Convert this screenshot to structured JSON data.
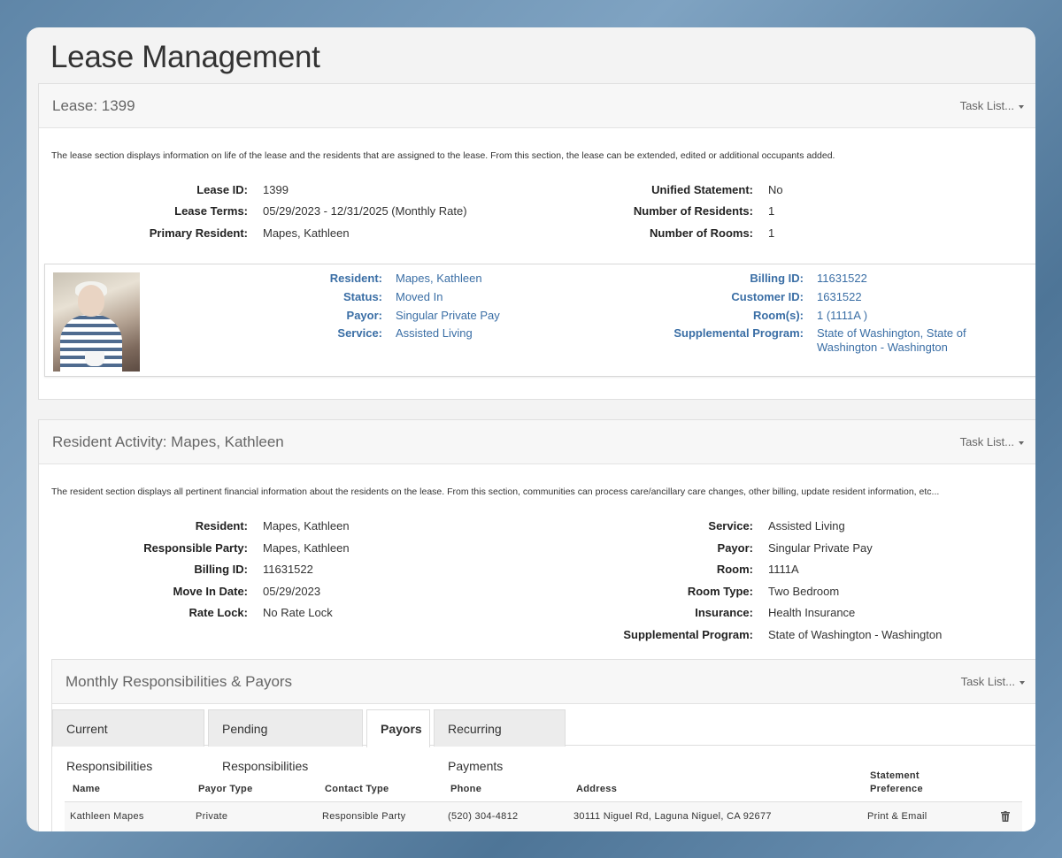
{
  "page": {
    "title": "Lease Management"
  },
  "lease_panel": {
    "title": "Lease: 1399",
    "task_list": "Task List...",
    "description": "The lease section displays information on life of the lease and the residents that are assigned to the lease. From this section, the lease can be extended, edited or additional occupants added.",
    "fields_left": [
      {
        "label": "Lease ID:",
        "value": "1399"
      },
      {
        "label": "Lease Terms:",
        "value": "05/29/2023 - 12/31/2025 (Monthly Rate)"
      },
      {
        "label": "Primary Resident:",
        "value": "Mapes, Kathleen"
      }
    ],
    "fields_right": [
      {
        "label": "Unified Statement:",
        "value": "No"
      },
      {
        "label": "Number of Residents:",
        "value": "1"
      },
      {
        "label": "Number of Rooms:",
        "value": "1"
      }
    ],
    "resident_card": {
      "left": [
        {
          "label": "Resident:",
          "value": "Mapes, Kathleen"
        },
        {
          "label": "Status:",
          "value": "Moved In"
        },
        {
          "label": "Payor:",
          "value": "Singular Private Pay"
        },
        {
          "label": "Service:",
          "value": "Assisted Living"
        }
      ],
      "right": [
        {
          "label": "Billing ID:",
          "value": "11631522"
        },
        {
          "label": "Customer ID:",
          "value": "1631522"
        },
        {
          "label": "Room(s):",
          "value": "1 (1111A )"
        },
        {
          "label": "Supplemental Program:",
          "value": "State of Washington, State of Washington - Washington"
        }
      ]
    }
  },
  "activity_panel": {
    "title": "Resident Activity: Mapes, Kathleen",
    "task_list": "Task List...",
    "description": "The resident section displays all pertinent financial information about the residents on the lease. From this section, communities can process care/ancillary care changes, other billing, update resident information, etc...",
    "fields_left": [
      {
        "label": "Resident:",
        "value": "Mapes, Kathleen"
      },
      {
        "label": "Responsible Party:",
        "value": "Mapes, Kathleen"
      },
      {
        "label": "Billing ID:",
        "value": "11631522"
      },
      {
        "label": "Move In Date:",
        "value": "05/29/2023"
      },
      {
        "label": "Rate Lock:",
        "value": "No Rate Lock"
      }
    ],
    "fields_right": [
      {
        "label": "Service:",
        "value": "Assisted Living"
      },
      {
        "label": "Payor:",
        "value": "Singular Private Pay"
      },
      {
        "label": "Room:",
        "value": "1111A"
      },
      {
        "label": "Room Type:",
        "value": "Two Bedroom"
      },
      {
        "label": "Insurance:",
        "value": "Health Insurance"
      },
      {
        "label": "Supplemental Program:",
        "value": "State of Washington - Washington"
      }
    ]
  },
  "responsibilities": {
    "title": "Monthly Responsibilities & Payors",
    "task_list": "Task List...",
    "tabs": [
      {
        "label": "Current Responsibilities"
      },
      {
        "label": "Pending Responsibilities"
      },
      {
        "label": "Payors",
        "active": true
      },
      {
        "label": "Recurring Payments"
      }
    ],
    "columns": [
      "Name",
      "Payor Type",
      "Contact Type",
      "Phone",
      "Address",
      "Statement Preference"
    ],
    "rows": [
      {
        "name": "Kathleen Mapes",
        "payor_type": "Private",
        "contact_type": "Responsible Party",
        "phone": "(520) 304-4812",
        "address": "30111 Niguel Rd, Laguna Niguel, CA 92677",
        "statement_preference": "Print & Email"
      }
    ]
  },
  "colors": {
    "link_blue": "#3a6ea5",
    "panel_header": "#f7f7f7"
  },
  "icons": {
    "task_caret": "caret-down-icon",
    "delete": "trash-icon"
  }
}
